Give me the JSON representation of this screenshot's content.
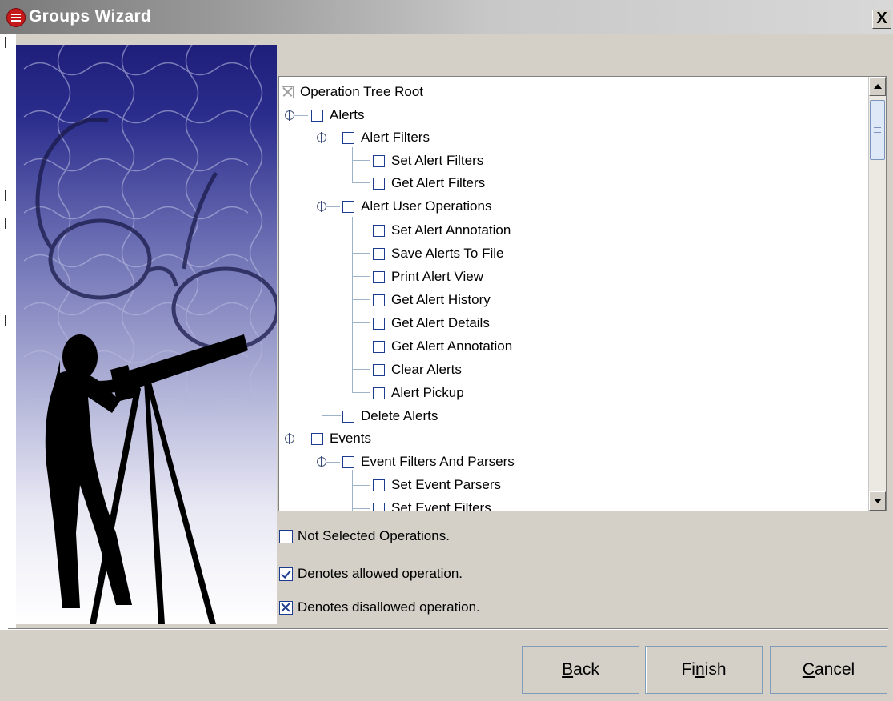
{
  "window": {
    "title": "Groups Wizard",
    "close_label": "X"
  },
  "tree": {
    "rows": [
      "Operation Tree Root",
      "Alerts",
      "Alert Filters",
      "Set Alert Filters",
      "Get Alert Filters",
      "Alert User Operations",
      "Set Alert Annotation",
      "Save Alerts To File",
      "Print Alert View",
      "Get Alert History",
      "Get Alert Details",
      "Get Alert Annotation",
      "Clear Alerts",
      "Alert Pickup",
      "Delete Alerts",
      "Events",
      "Event Filters And Parsers",
      "Set Event Parsers",
      "Set Event Filters"
    ]
  },
  "legend": {
    "not_selected": "Not Selected Operations.",
    "allowed": "Denotes allowed operation.",
    "disallowed": "Denotes disallowed operation."
  },
  "buttons": {
    "back": {
      "mnemonic": "B",
      "rest": "ack"
    },
    "finish": {
      "pre": "Fi",
      "mnemonic": "n",
      "rest": "ish"
    },
    "cancel": {
      "mnemonic": "C",
      "rest": "ancel"
    }
  },
  "icons": {
    "app": "groups-app-icon",
    "close": "close-icon",
    "scroll_up": "arrow-up-icon",
    "scroll_down": "arrow-down-icon",
    "expand": "tree-toggle-icon"
  },
  "colors": {
    "accent": "#1d3c8e",
    "title_gradient_start": "#7a7a7a",
    "panel": "#d4d0c8"
  }
}
